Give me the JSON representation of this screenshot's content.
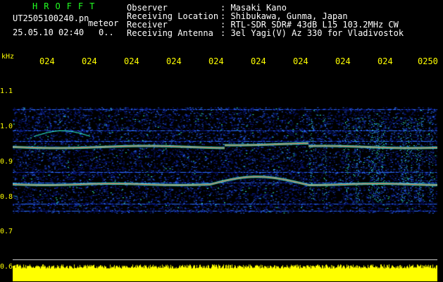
{
  "header": {
    "brand": "HROFFT",
    "filename": "UT2505100240.pn",
    "mode": "meteor",
    "datetime": "25.05.10 02:40",
    "count": "0.."
  },
  "station": [
    {
      "label": "Observer",
      "value": ": Masaki Kano"
    },
    {
      "label": "Receiving Location",
      "value": ": Shibukawa, Gunma, Japan"
    },
    {
      "label": "Receiver",
      "value": ": RTL-SDR SDR# 43dB L15 103.2MHz CW"
    },
    {
      "label": "Receiving Antenna",
      "value": ": 3el Yagi(V) Az 330 for Vladivostok"
    }
  ],
  "axis": {
    "unit": "kHz",
    "y_ticks": [
      "1.1",
      "1.0",
      "0.9",
      "0.8",
      "0.7",
      "0.6"
    ],
    "x_ticks": [
      "024",
      "024",
      "024",
      "024",
      "024",
      "024",
      "024",
      "024",
      "024",
      "0250"
    ]
  },
  "colors": {
    "background": "#000000",
    "header_text": "#22ff22",
    "axis_text": "#ffff00",
    "noise_bar": "#ffff00",
    "waterfall_low": "#0a1a8a",
    "waterfall_mid": "#2b6cff",
    "waterfall_high": "#33ffcc",
    "trace": "#ff3030"
  }
}
